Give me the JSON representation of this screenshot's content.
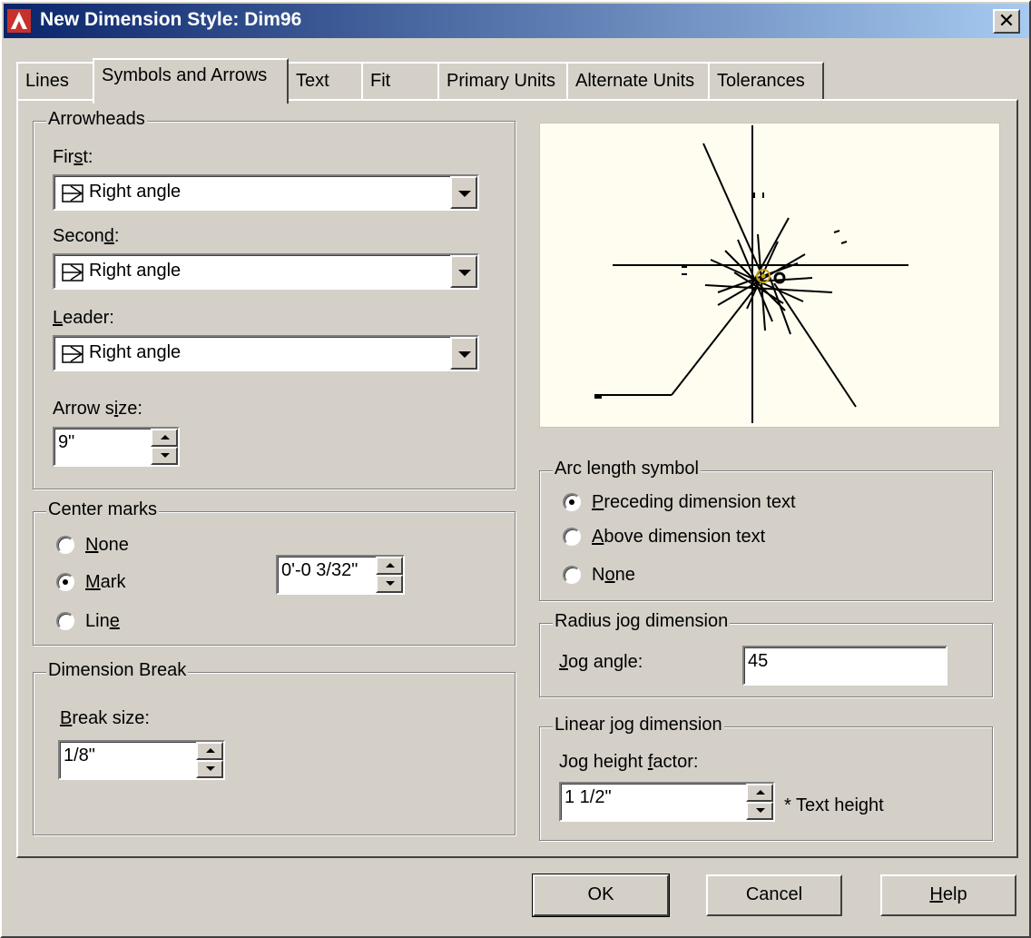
{
  "window": {
    "title": "New Dimension Style: Dim96",
    "close_label": "✕"
  },
  "tabs": [
    {
      "label": "Lines"
    },
    {
      "label": "Symbols and Arrows"
    },
    {
      "label": "Text"
    },
    {
      "label": "Fit"
    },
    {
      "label": "Primary Units"
    },
    {
      "label": "Alternate Units"
    },
    {
      "label": "Tolerances"
    }
  ],
  "arrowheads": {
    "group_label": "Arrowheads",
    "first": {
      "label_pre": "Fir",
      "label_key": "s",
      "label_post": "t:",
      "value": "Right angle"
    },
    "second": {
      "label_pre": "Secon",
      "label_key": "d",
      "label_post": ":",
      "value": "Right angle"
    },
    "leader": {
      "label_pre": "",
      "label_key": "L",
      "label_post": "eader:",
      "value": "Right angle"
    },
    "arrow_size": {
      "label_pre": "Arrow s",
      "label_key": "i",
      "label_post": "ze:",
      "value": "9\""
    }
  },
  "center_marks": {
    "group_label": "Center marks",
    "none": {
      "label_key": "N",
      "label_post": "one",
      "selected": false
    },
    "mark": {
      "label_key": "M",
      "label_post": "ark",
      "selected": true
    },
    "line": {
      "label_pre": "Lin",
      "label_key": "e",
      "selected": false
    },
    "size_value": "0'-0 3/32\""
  },
  "dimension_break": {
    "group_label": "Dimension Break",
    "break_size": {
      "label_key": "B",
      "label_post": "reak size:",
      "value": "1/8\""
    }
  },
  "arc_length": {
    "group_label": "Arc length symbol",
    "preceding": {
      "label_key": "P",
      "label_post": "receding dimension text",
      "selected": true
    },
    "above": {
      "label_key": "A",
      "label_post": "bove dimension text",
      "selected": false
    },
    "none": {
      "label_pre": "N",
      "label_key": "o",
      "label_post": "ne",
      "selected": false
    }
  },
  "radius_jog": {
    "group_label": "Radius jog dimension",
    "jog_angle": {
      "label_key": "J",
      "label_post": "og angle:",
      "value": "45"
    }
  },
  "linear_jog": {
    "group_label": "Linear jog dimension",
    "jog_height": {
      "label_pre": "Jog height ",
      "label_key": "f",
      "label_post": "actor:",
      "value": "1 1/2\"",
      "suffix": "* Text height"
    }
  },
  "buttons": {
    "ok": "OK",
    "cancel": "Cancel",
    "help_key": "H",
    "help_post": "elp"
  }
}
